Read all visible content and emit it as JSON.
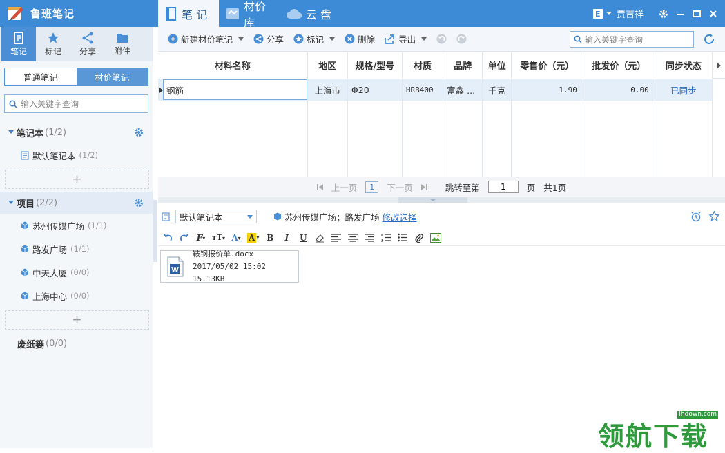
{
  "app": {
    "title": "鲁班笔记"
  },
  "main_tabs": [
    {
      "label": "笔 记",
      "active": true
    },
    {
      "label": "材价库",
      "active": false
    },
    {
      "label": "云 盘",
      "active": false
    }
  ],
  "user": {
    "name": "贾吉祥"
  },
  "sidebar": {
    "icons": [
      {
        "label": "笔记",
        "icon": "note-icon",
        "active": true
      },
      {
        "label": "标记",
        "icon": "star-icon",
        "active": false
      },
      {
        "label": "分享",
        "icon": "share-icon",
        "active": false
      },
      {
        "label": "附件",
        "icon": "folder-icon",
        "active": false
      }
    ],
    "segments": [
      "普通笔记",
      "材价笔记"
    ],
    "active_segment": "材价笔记",
    "search_placeholder": "输入关键字查询",
    "notebook_group": {
      "label": "笔记本",
      "count": "(1/2)"
    },
    "notebooks": [
      {
        "label": "默认笔记本",
        "count": "(1/2)"
      }
    ],
    "project_group": {
      "label": "项目",
      "count": "(2/2)"
    },
    "projects": [
      {
        "label": "苏州传媒广场",
        "count": "(1/1)"
      },
      {
        "label": "路发广场",
        "count": "(1/1)"
      },
      {
        "label": "中天大厦",
        "count": "(0/0)"
      },
      {
        "label": "上海中心",
        "count": "(0/0)"
      }
    ],
    "trash": {
      "label": "废纸篓",
      "count": "(0/0)"
    },
    "add_symbol": "+"
  },
  "toolbar": {
    "new_label": "新建材价笔记",
    "share_label": "分享",
    "mark_label": "标记",
    "delete_label": "删除",
    "export_label": "导出",
    "search_placeholder": "输入关键字查询"
  },
  "table": {
    "columns": [
      "材料名称",
      "地区",
      "规格/型号",
      "材质",
      "品牌",
      "单位",
      "零售价（元）",
      "批发价（元）",
      "同步状态"
    ],
    "rows": [
      {
        "name": "钢筋",
        "region": "上海市",
        "spec": "Φ20",
        "material": "HRB400",
        "brand": "富鑫 ...",
        "unit": "千克",
        "retail": "1.90",
        "wholesale": "0.00",
        "sync": "已同步"
      }
    ]
  },
  "pager": {
    "prev": "上一页",
    "current": "1",
    "next": "下一页",
    "jump_label": "跳转至第",
    "jump_value": "1",
    "page_suffix": "页",
    "total": "共1页"
  },
  "note": {
    "notebook": "默认笔记本",
    "projects_text": "苏州传媒广场；路发广场",
    "modify_link": "修改选择",
    "attachment": {
      "filename": "鞍钢报价单.docx",
      "meta": "2017/05/02 15:02 15.13KB"
    }
  },
  "watermark": {
    "text": "领航下载",
    "url": "lhdown.com"
  },
  "colors": {
    "primary": "#3d8ad6",
    "selected_row": "#e5effa",
    "link": "#2a6cc4"
  }
}
